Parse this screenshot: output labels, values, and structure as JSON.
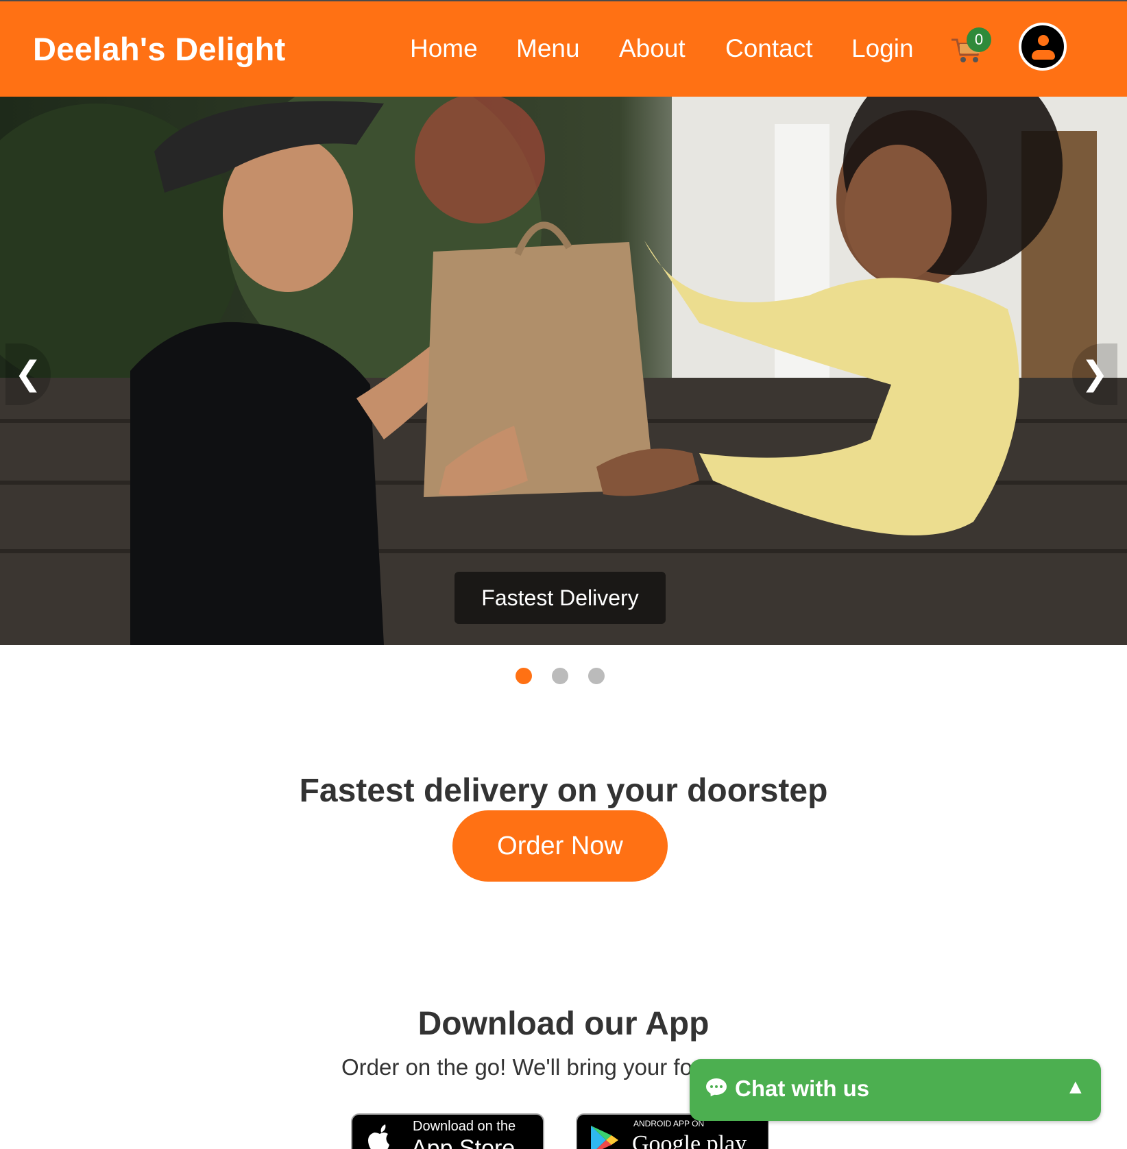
{
  "header": {
    "brand": "Deelah's Delight",
    "nav": [
      {
        "label": "Home"
      },
      {
        "label": "Menu"
      },
      {
        "label": "About"
      },
      {
        "label": "Contact"
      },
      {
        "label": "Login"
      }
    ],
    "cart_count": "0",
    "icons": {
      "cart": "shopping-cart-icon",
      "profile": "user-profile-icon"
    }
  },
  "carousel": {
    "prev_glyph": "❮",
    "next_glyph": "❯",
    "caption": "Fastest Delivery",
    "slides_total": 3,
    "active_index": 0
  },
  "promo": {
    "title": "Fastest delivery on your doorstep",
    "button": "Order Now"
  },
  "download": {
    "title": "Download our App",
    "subtitle": "Order on the go! We'll bring your foo",
    "appstore": {
      "small": "Download on the",
      "big": "App Store"
    },
    "googleplay": {
      "small": "ANDROID APP ON",
      "big": "Google play"
    }
  },
  "chat": {
    "label": "Chat with us",
    "toggle": "▲"
  },
  "colors": {
    "accent": "#ff7114",
    "badge": "#2f8a3a",
    "chat": "#4caf50",
    "text": "#333333"
  }
}
